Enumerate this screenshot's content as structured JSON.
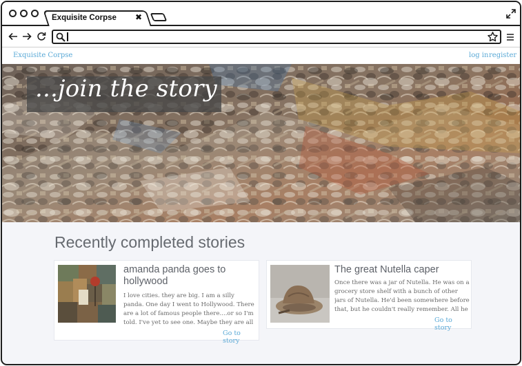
{
  "browser": {
    "tab_title": "Exquisite Corpse",
    "tab_close": "✖",
    "address_value": ""
  },
  "site_nav": {
    "brand": "Exquisite Corpse",
    "login": "log in",
    "register": "register"
  },
  "hero": {
    "tagline": "...join the story"
  },
  "main": {
    "section_title": "Recently completed stories",
    "stories": [
      {
        "title": "amanda panda goes to hollywood",
        "excerpt": "I love cities. they are big. I am a silly panda. One day I went to Hollywood. There are a lot of famous people there....or so I'm told. I've yet to see one. Maybe they are all antisocial",
        "link": "Go to story"
      },
      {
        "title": "The great Nutella caper",
        "excerpt": "Once there was a jar of Nutella. He was on a grocery store shelf with a bunch of other jars of Nutella. He'd been somewhere before that, but he couldn't really remember. All he knew",
        "link": "Go to story"
      }
    ]
  },
  "colors": {
    "link": "#5aa9d6",
    "background": "#f4f5f9",
    "heading": "#666a70"
  }
}
